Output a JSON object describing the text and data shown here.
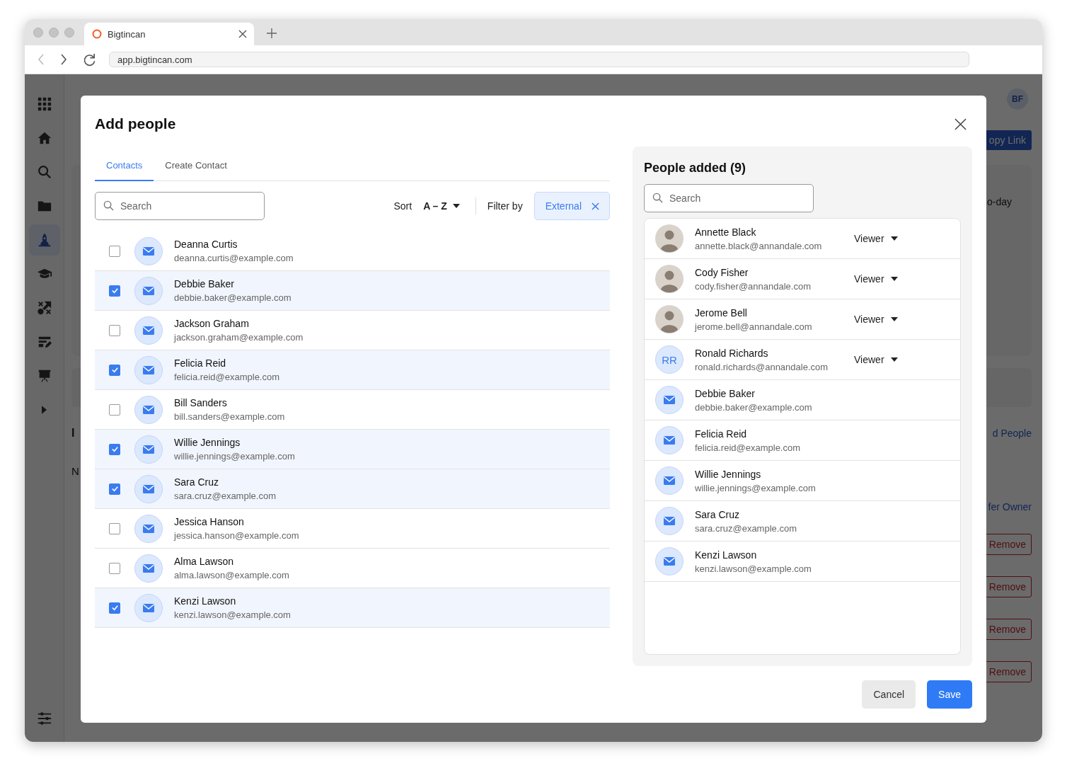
{
  "browser": {
    "tab_title": "Bigtincan",
    "url": "app.bigtincan.com"
  },
  "sidebar": {
    "items": [
      {
        "kind": "apps",
        "selected": false
      },
      {
        "kind": "home",
        "selected": false
      },
      {
        "kind": "search",
        "selected": false
      },
      {
        "kind": "folder",
        "selected": false
      },
      {
        "kind": "rocket",
        "selected": true
      },
      {
        "kind": "cap",
        "selected": false
      },
      {
        "kind": "shuffle",
        "selected": false
      },
      {
        "kind": "note",
        "selected": false
      },
      {
        "kind": "easel",
        "selected": false
      },
      {
        "kind": "caret",
        "selected": false
      }
    ]
  },
  "background": {
    "avatar_initials": "BF",
    "link_button": "opy Link",
    "card_text": "o-day",
    "heading_letter": "I",
    "label_letter": "N",
    "people_link": "d People",
    "owner_link": "fer Owner",
    "remove_buttons": [
      "Remove",
      "Remove",
      "Remove",
      "Remove"
    ]
  },
  "modal": {
    "title": "Add people",
    "tabs": [
      {
        "label": "Contacts",
        "selected": true
      },
      {
        "label": "Create Contact",
        "selected": false
      }
    ],
    "search": {
      "placeholder": "Search"
    },
    "sort": {
      "label": "Sort",
      "value": "A – Z"
    },
    "filter": {
      "label": "Filter by",
      "chip": "External"
    },
    "contacts": [
      {
        "name": "Deanna Curtis",
        "email": "deanna.curtis@example.com",
        "checked": false
      },
      {
        "name": "Debbie Baker",
        "email": "debbie.baker@example.com",
        "checked": true
      },
      {
        "name": "Jackson Graham",
        "email": "jackson.graham@example.com",
        "checked": false
      },
      {
        "name": "Felicia Reid",
        "email": "felicia.reid@example.com",
        "checked": true
      },
      {
        "name": "Bill Sanders",
        "email": "bill.sanders@example.com",
        "checked": false
      },
      {
        "name": "Willie Jennings",
        "email": "willie.jennings@example.com",
        "checked": true
      },
      {
        "name": "Sara Cruz",
        "email": "sara.cruz@example.com",
        "checked": true
      },
      {
        "name": "Jessica Hanson",
        "email": "jessica.hanson@example.com",
        "checked": false
      },
      {
        "name": "Alma Lawson",
        "email": "alma.lawson@example.com",
        "checked": false
      },
      {
        "name": "Kenzi Lawson",
        "email": "kenzi.lawson@example.com",
        "checked": true
      }
    ],
    "panel": {
      "title": "People added (9)",
      "search": {
        "placeholder": "Search"
      },
      "people": [
        {
          "name": "Annette Black",
          "email": "annette.black@annandale.com",
          "kind": "photo",
          "role": "Viewer"
        },
        {
          "name": "Cody Fisher",
          "email": "cody.fisher@annandale.com",
          "kind": "photo",
          "role": "Viewer"
        },
        {
          "name": "Jerome Bell",
          "email": "jerome.bell@annandale.com",
          "kind": "photo",
          "role": "Viewer"
        },
        {
          "name": "Ronald Richards",
          "email": "ronald.richards@annandale.com",
          "kind": "initials",
          "initials": "RR",
          "role": "Viewer"
        },
        {
          "name": "Debbie Baker",
          "email": "debbie.baker@example.com",
          "kind": "email"
        },
        {
          "name": "Felicia Reid",
          "email": "felicia.reid@example.com",
          "kind": "email"
        },
        {
          "name": "Willie Jennings",
          "email": "willie.jennings@example.com",
          "kind": "email"
        },
        {
          "name": "Sara Cruz",
          "email": "sara.cruz@example.com",
          "kind": "email"
        },
        {
          "name": "Kenzi Lawson",
          "email": "kenzi.lawson@example.com",
          "kind": "email"
        }
      ]
    },
    "buttons": [
      {
        "label": "Cancel",
        "kind": "secondary"
      },
      {
        "label": "Save",
        "kind": "primary"
      }
    ]
  }
}
